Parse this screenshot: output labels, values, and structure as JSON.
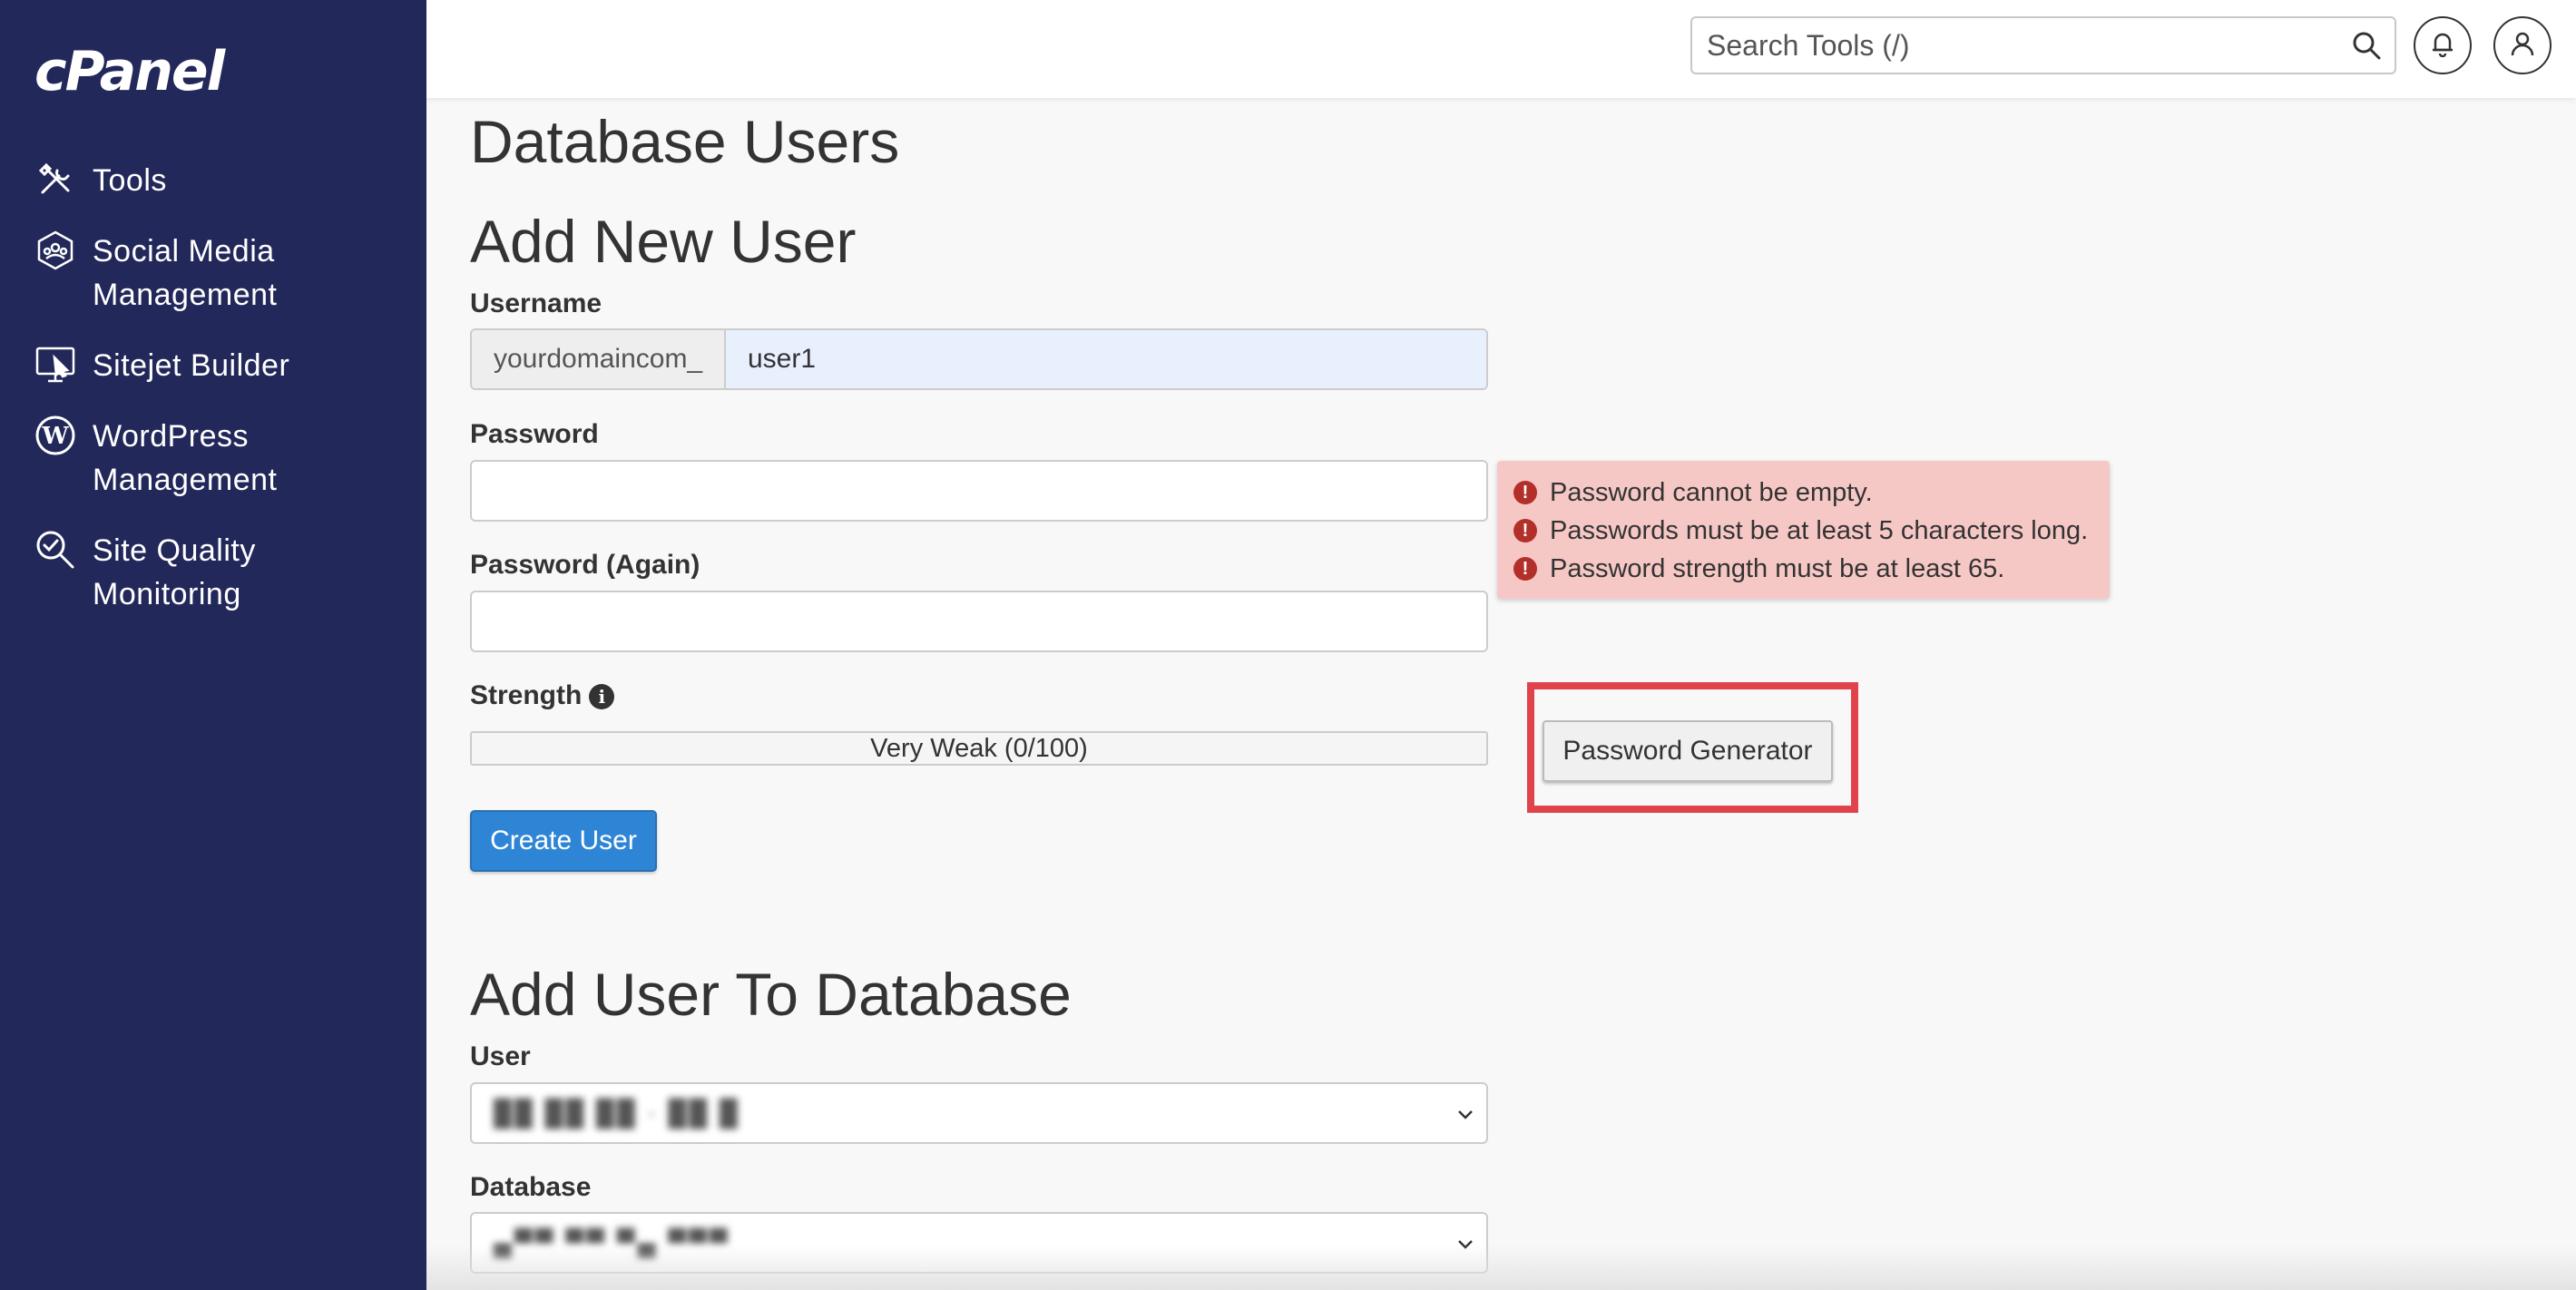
{
  "sidebar": {
    "logo": "cPanel",
    "items": [
      {
        "label": "Tools",
        "icon": "tools-icon"
      },
      {
        "label": "Social Media Management",
        "icon": "social-media-icon"
      },
      {
        "label": "Sitejet Builder",
        "icon": "sitejet-icon"
      },
      {
        "label": "WordPress Management",
        "icon": "wordpress-icon"
      },
      {
        "label": "Site Quality Monitoring",
        "icon": "site-quality-icon"
      }
    ]
  },
  "header": {
    "search_placeholder": "Search Tools (/)",
    "icons": [
      "search-icon",
      "bell-icon",
      "user-icon"
    ]
  },
  "page": {
    "title": "Database Users"
  },
  "add_user": {
    "heading": "Add New User",
    "username_label": "Username",
    "username_prefix": "yourdomaincom_",
    "username_value": "user1",
    "password_label": "Password",
    "password_value": "",
    "password_again_label": "Password (Again)",
    "password_again_value": "",
    "strength_label": "Strength",
    "strength_text": "Very Weak (0/100)",
    "strength_value": 0,
    "create_button": "Create User",
    "password_generator_button": "Password Generator",
    "errors": [
      "Password cannot be empty.",
      "Passwords must be at least 5 characters long.",
      "Password strength must be at least 65."
    ]
  },
  "add_to_db": {
    "heading": "Add User To Database",
    "user_label": "User",
    "user_value": "██ ██  ██     ·  ██      █",
    "database_label": "Database",
    "database_value": "▄▀▀ ▀▀        ▀▄   ▀▀▀"
  },
  "colors": {
    "sidebar_bg": "#23285a",
    "primary_button": "#2f85d5",
    "error_bg": "#f6c8c5",
    "highlight": "#e0434c"
  }
}
